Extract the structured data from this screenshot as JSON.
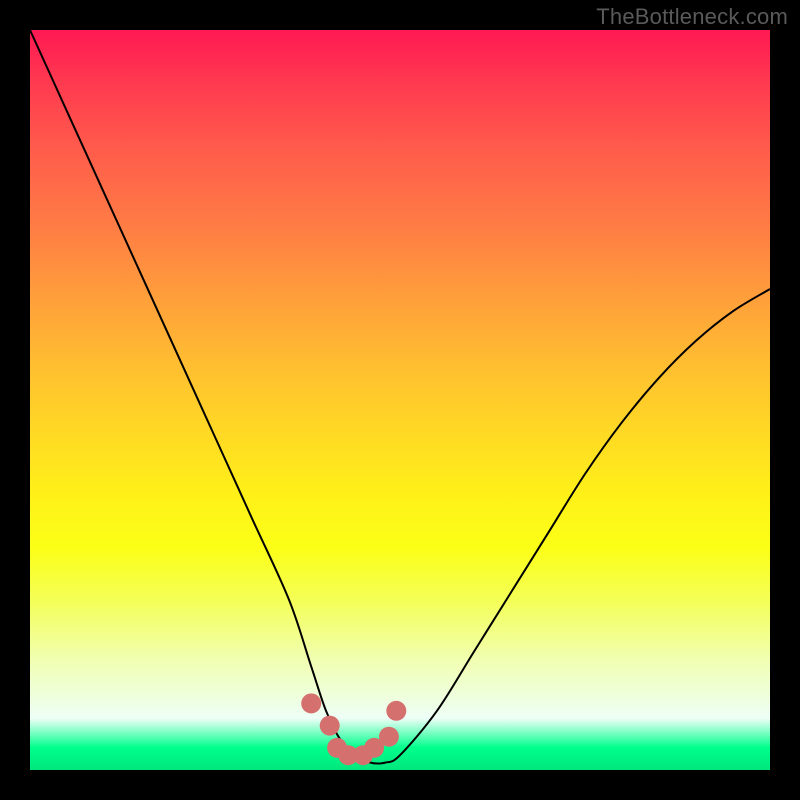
{
  "watermark": "TheBottleneck.com",
  "chart_data": {
    "type": "line",
    "title": "",
    "xlabel": "",
    "ylabel": "",
    "xlim": [
      0,
      100
    ],
    "ylim": [
      0,
      100
    ],
    "grid": false,
    "legend": false,
    "series": [
      {
        "name": "bottleneck-curve",
        "x": [
          0,
          5,
          10,
          15,
          20,
          25,
          30,
          35,
          38,
          40,
          42,
          44,
          46,
          48,
          50,
          55,
          60,
          65,
          70,
          75,
          80,
          85,
          90,
          95,
          100
        ],
        "y": [
          100,
          89,
          78,
          67,
          56,
          45,
          34,
          23,
          14,
          8,
          4,
          2,
          1,
          1,
          2,
          8,
          16,
          24,
          32,
          40,
          47,
          53,
          58,
          62,
          65
        ]
      }
    ],
    "markers": {
      "name": "bottom-dots",
      "x": [
        38,
        40.5,
        41.5,
        43,
        45,
        46.5,
        48.5,
        49.5
      ],
      "y": [
        9,
        6,
        3,
        2,
        2,
        3,
        4.5,
        8
      ],
      "color": "#d4716f"
    },
    "background_gradient": {
      "stops": [
        {
          "pos": 0.0,
          "color": "#ff1953"
        },
        {
          "pos": 0.5,
          "color": "#ffe11f"
        },
        {
          "pos": 0.96,
          "color": "#efffef"
        },
        {
          "pos": 1.0,
          "color": "#00e67d"
        }
      ]
    }
  }
}
